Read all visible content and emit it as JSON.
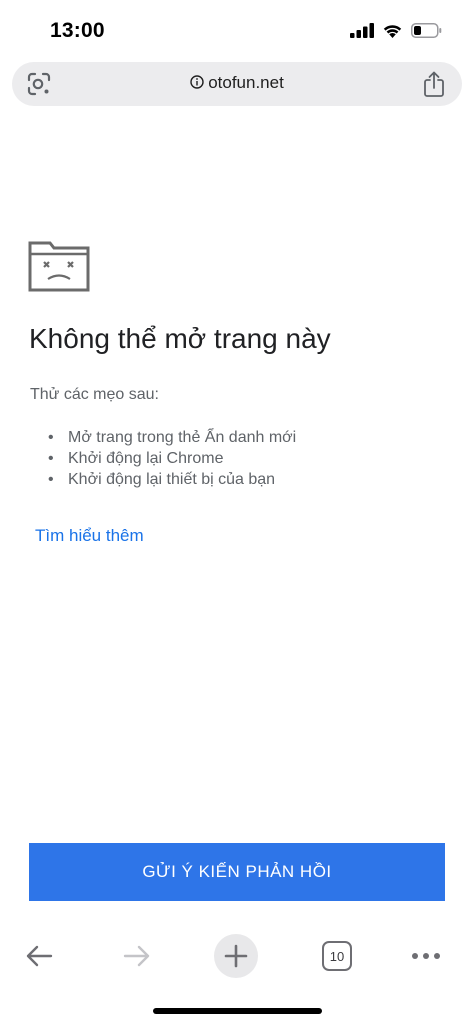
{
  "status_bar": {
    "time": "13:00",
    "icons": [
      "cellular-signal-icon",
      "wifi-icon",
      "battery-icon"
    ]
  },
  "address_bar": {
    "url": "otofun.net",
    "left_icon": "lens-icon",
    "info_icon": "info-icon",
    "right_icon": "share-icon"
  },
  "error_page": {
    "icon": "sad-folder-icon",
    "title": "Không thể mở trang này",
    "tips_intro": "Thử các mẹo sau:",
    "tips": [
      "Mở trang trong thẻ Ẩn danh mới",
      "Khởi động lại Chrome",
      "Khởi động lại thiết bị của bạn"
    ],
    "learn_more": "Tìm hiểu thêm",
    "feedback_button": "GỬI Ý KIẾN PHẢN HỒI"
  },
  "toolbar": {
    "tab_count": "10",
    "buttons": [
      "back-arrow-icon",
      "forward-arrow-icon",
      "plus-icon",
      "tabs-icon",
      "more-dots-icon"
    ]
  },
  "colors": {
    "accent_blue": "#2e75e8",
    "link_blue": "#1a73e8",
    "address_bar_bg": "#ececee"
  }
}
